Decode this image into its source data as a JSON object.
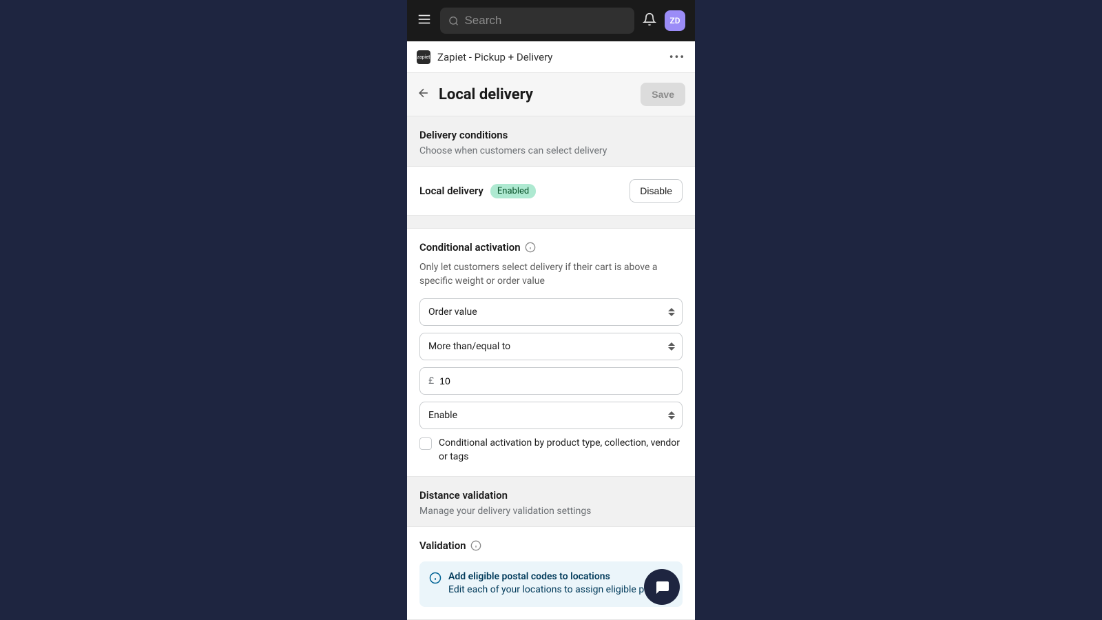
{
  "topbar": {
    "search_placeholder": "Search",
    "avatar_initials": "ZD"
  },
  "app": {
    "name": "Zapiet - Pickup + Delivery",
    "logo_text": "zapiet"
  },
  "header": {
    "title": "Local delivery",
    "save_label": "Save"
  },
  "delivery_conditions": {
    "title": "Delivery conditions",
    "subtitle": "Choose when customers can select delivery",
    "status_label": "Local delivery",
    "status_badge": "Enabled",
    "disable_label": "Disable"
  },
  "conditional": {
    "title": "Conditional activation",
    "description": "Only let customers select delivery if their cart is above a specific weight or order value",
    "metric": "Order value",
    "operator": "More than/equal to",
    "currency": "£",
    "value": "10",
    "action": "Enable",
    "checkbox_label": "Conditional activation by product type, collection, vendor or tags"
  },
  "distance": {
    "title": "Distance validation",
    "subtitle": "Manage your delivery validation settings",
    "validation_label": "Validation",
    "banner_title": "Add eligible postal codes to locations",
    "banner_text": "Edit each of your locations to assign eligible postal"
  }
}
